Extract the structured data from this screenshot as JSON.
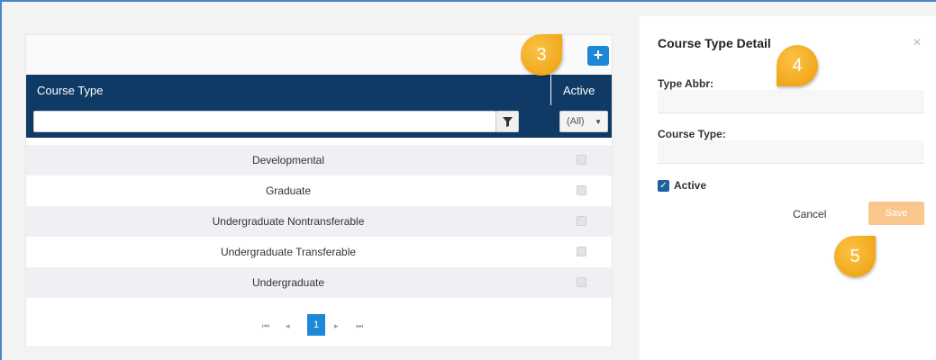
{
  "grid": {
    "add_icon": "plus-icon",
    "columns": {
      "type": "Course Type",
      "active": "Active"
    },
    "filter": {
      "value": "",
      "placeholder": "",
      "active_selected": "(All)"
    },
    "rows": [
      {
        "name": "Developmental",
        "active": false
      },
      {
        "name": "Graduate",
        "active": false
      },
      {
        "name": "Undergraduate Nontransferable",
        "active": false
      },
      {
        "name": "Undergraduate Transferable",
        "active": false
      },
      {
        "name": "Undergraduate",
        "active": false
      }
    ],
    "pager": {
      "first": "⏮",
      "prev": "◂",
      "current": "1",
      "next": "▸",
      "last": "⏭"
    }
  },
  "detail": {
    "title": "Course Type Detail",
    "close_icon": "close-icon",
    "type_abbr_label": "Type Abbr:",
    "type_abbr_value": "",
    "course_type_label": "Course Type:",
    "course_type_value": "",
    "active_label": "Active",
    "active_checked": true,
    "cancel_label": "Cancel",
    "save_label": "Save"
  },
  "markers": [
    "3",
    "4",
    "5"
  ],
  "colors": {
    "header": "#0f3a66",
    "accent": "#1e88d8",
    "marker": "#f2a81d",
    "save": "#f9c78c"
  }
}
